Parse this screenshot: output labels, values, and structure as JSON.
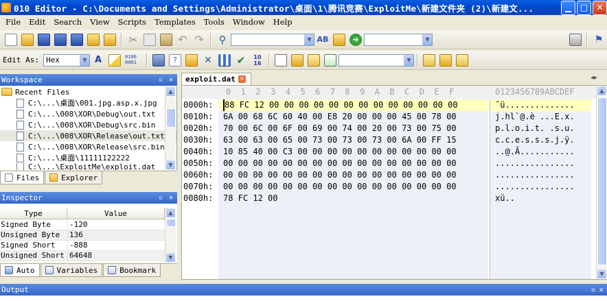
{
  "window": {
    "title": "010 Editor - C:\\Documents and Settings\\Administrator\\桌面\\1\\腾讯竞赛\\ExploitMe\\新建文件夹 (2)\\新建文..."
  },
  "menu": [
    "File",
    "Edit",
    "Search",
    "View",
    "Scripts",
    "Templates",
    "Tools",
    "Window",
    "Help"
  ],
  "toolbar1": {
    "search_value": "",
    "nav_value": ""
  },
  "toolbar2": {
    "edit_as_label": "Edit As:",
    "edit_as_value": "Hex",
    "calc_text": "0100\n0001",
    "template_value": ""
  },
  "workspace": {
    "title": "Workspace",
    "root": "Recent Files",
    "items": [
      "C:\\...\\桌面\\001.jpg.asp.x.jpg",
      "C:\\...\\008\\XOR\\Debug\\out.txt",
      "C:\\...\\008\\XOR\\Debug\\src.bin",
      "C:\\...\\008\\XOR\\Release\\out.txt",
      "C:\\...\\008\\XOR\\Release\\src.bin",
      "C:\\...\\桌面\\11111122222",
      "C:\\...\\ExploitMe\\exploit.dat"
    ],
    "tabs": [
      "Files",
      "Explorer"
    ]
  },
  "inspector": {
    "title": "Inspector",
    "col_type": "Type",
    "col_value": "Value",
    "rows": [
      {
        "type": "Signed Byte",
        "value": "-120"
      },
      {
        "type": "Unsigned Byte",
        "value": "136"
      },
      {
        "type": "Signed Short",
        "value": "-888"
      },
      {
        "type": "Unsigned Short",
        "value": "64648"
      }
    ],
    "tabs": [
      "Auto",
      "Variables",
      "Bookmark"
    ]
  },
  "editor": {
    "file_tab": "exploit.dat",
    "hex_header": "0  1  2  3  4  5  6  7  8  9  A  B  C  D  E  F",
    "ascii_header": "0123456789ABCDEF",
    "rows": [
      {
        "addr": "0000h:",
        "hex": "88 FC 12 00 00 00 00 00 00 00 00 00 00 00 00 00",
        "ascii": "ˆü.............."
      },
      {
        "addr": "0010h:",
        "hex": "6A 00 68 6C 60 40 00 E8 20 00 00 00 45 00 78 00",
        "ascii": "j.hl`@.è ...E.x."
      },
      {
        "addr": "0020h:",
        "hex": "70 00 6C 00 6F 00 69 00 74 00 20 00 73 00 75 00",
        "ascii": "p.l.o.i.t. .s.u."
      },
      {
        "addr": "0030h:",
        "hex": "63 00 63 00 65 00 73 00 73 00 73 00 6A 00 FF 15",
        "ascii": "c.c.e.s.s.s.j.ÿ."
      },
      {
        "addr": "0040h:",
        "hex": "10 85 40 00 C3 00 00 00 00 00 00 00 00 00 00 00",
        "ascii": "..@.Ã..........."
      },
      {
        "addr": "0050h:",
        "hex": "00 00 00 00 00 00 00 00 00 00 00 00 00 00 00 00",
        "ascii": "................"
      },
      {
        "addr": "0060h:",
        "hex": "00 00 00 00 00 00 00 00 00 00 00 00 00 00 00 00",
        "ascii": "................"
      },
      {
        "addr": "0070h:",
        "hex": "00 00 00 00 00 00 00 00 00 00 00 00 00 00 00 00",
        "ascii": "................"
      },
      {
        "addr": "0080h:",
        "hex": "78 FC 12 00",
        "ascii": "xü.."
      }
    ]
  },
  "output": {
    "title": "Output"
  }
}
